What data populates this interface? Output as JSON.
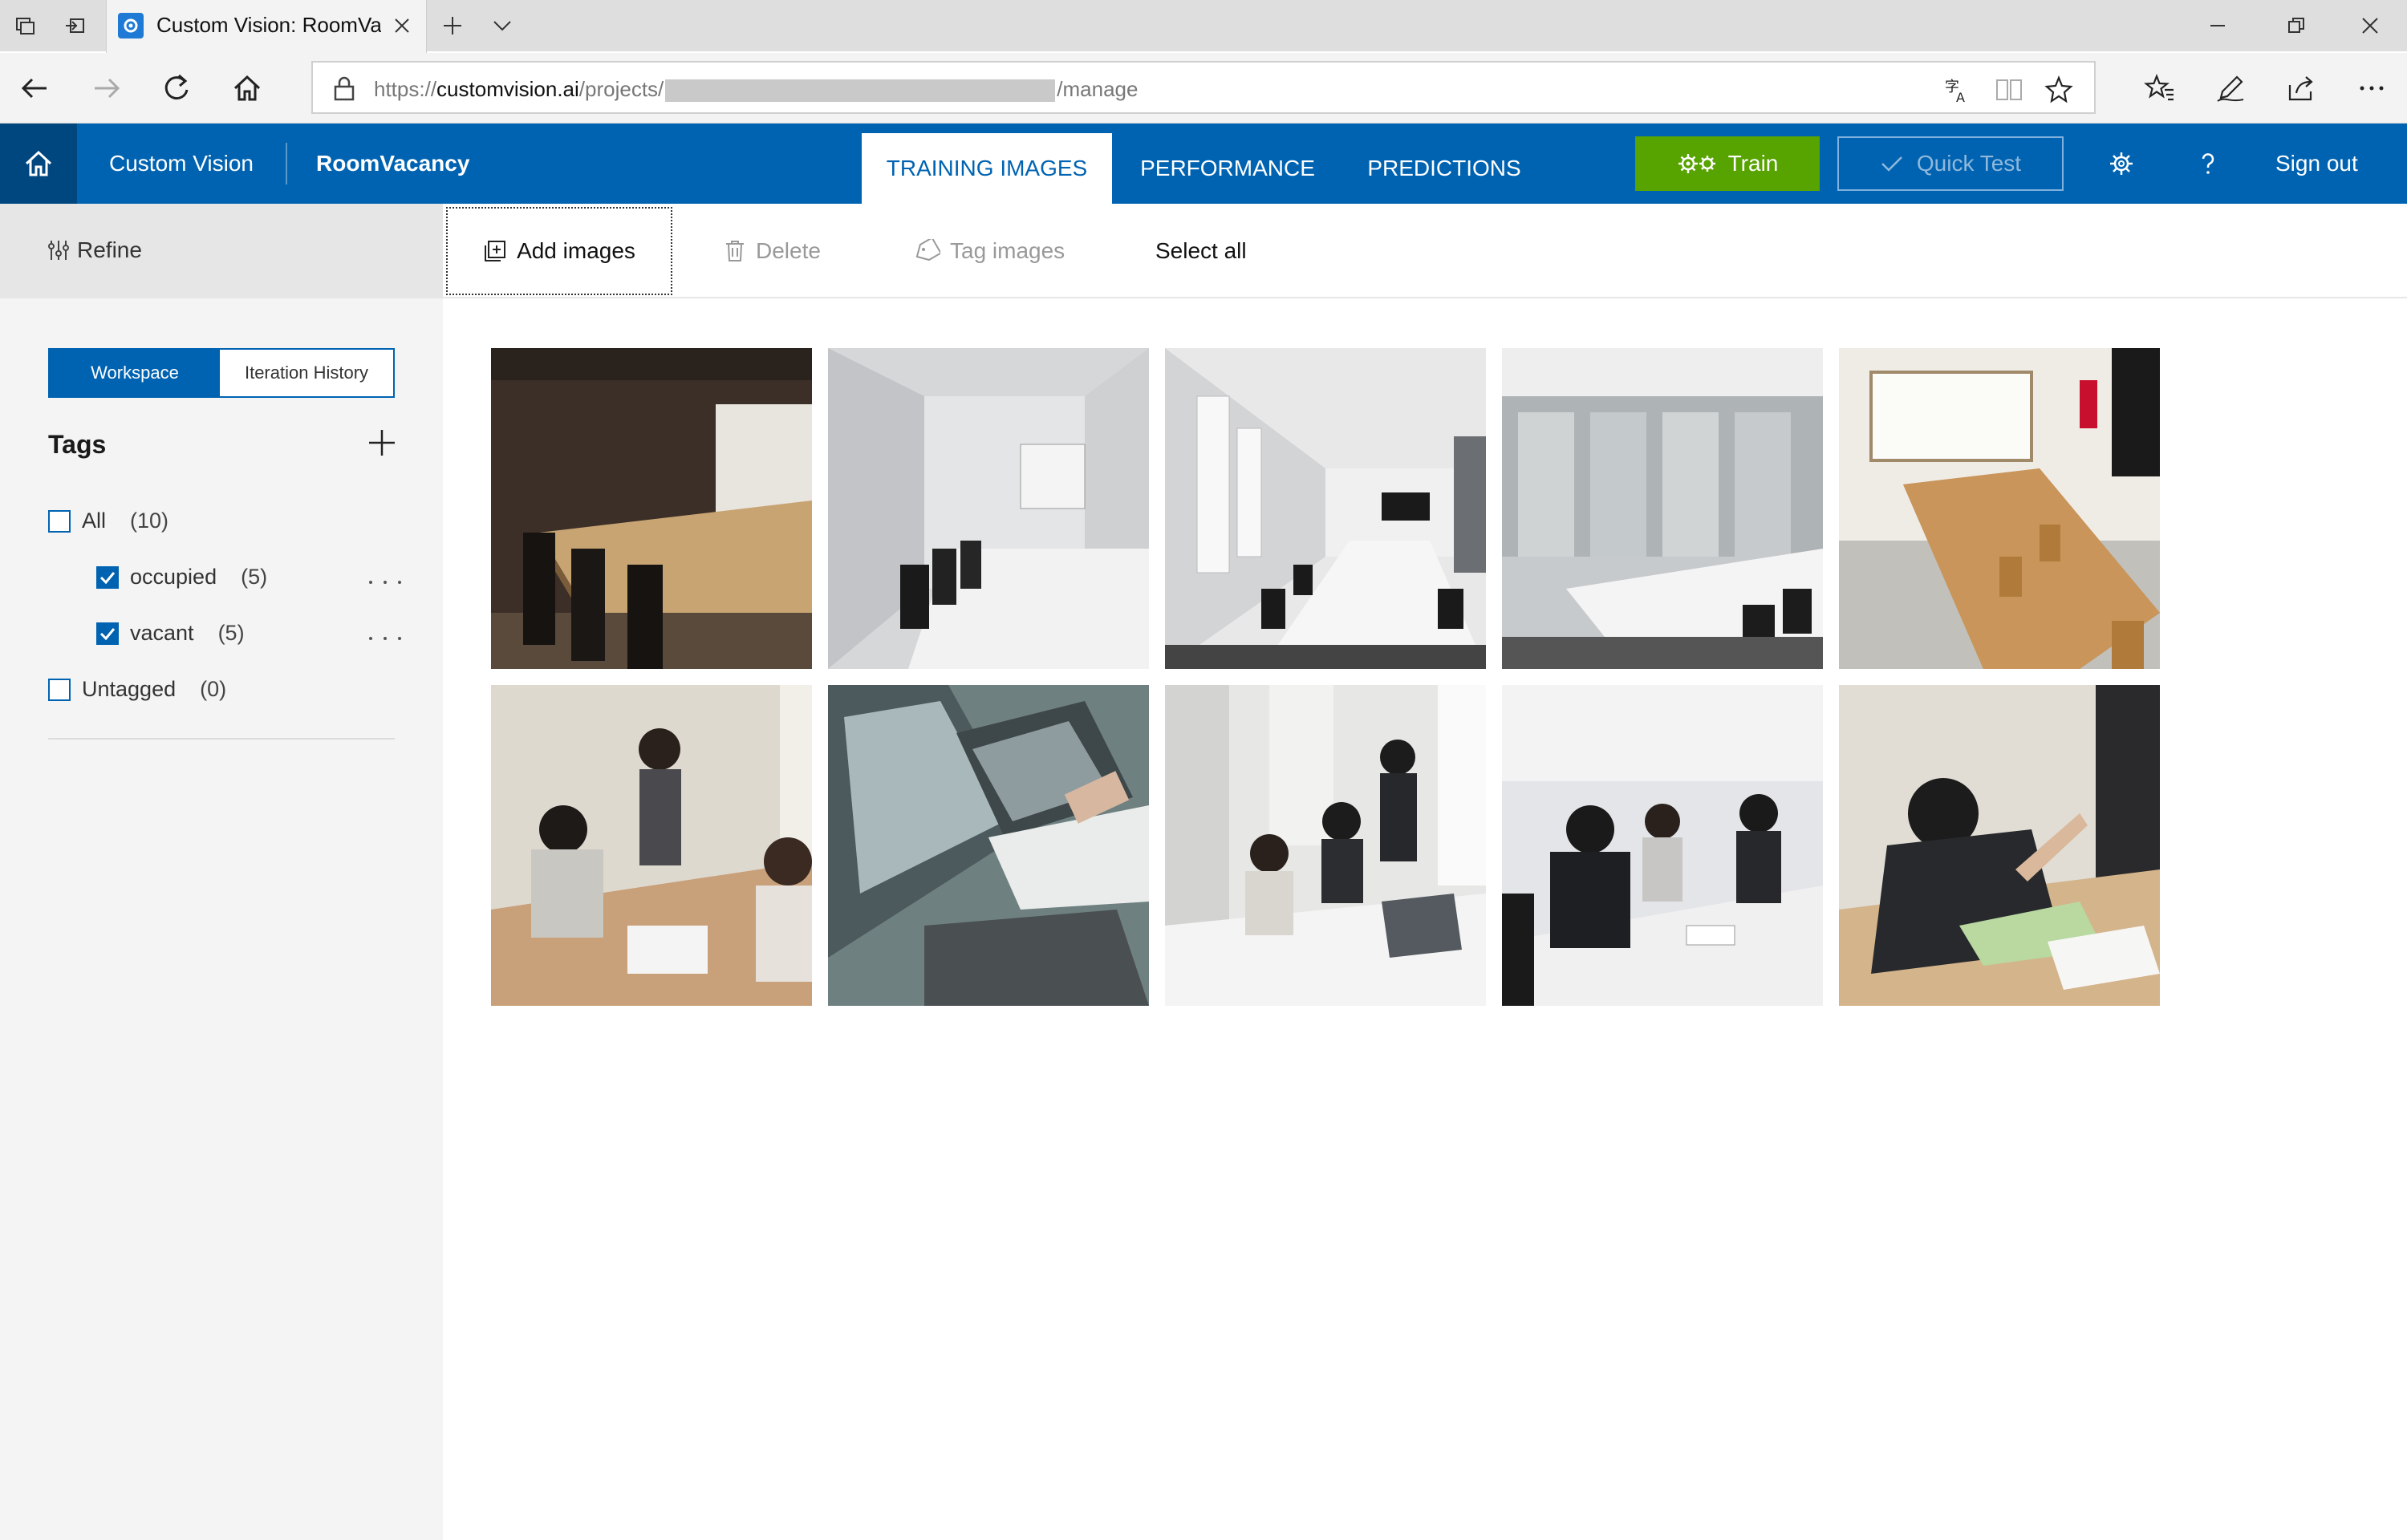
{
  "browser": {
    "tab_title": "Custom Vision: RoomVa",
    "url_scheme": "https://",
    "url_host": "customvision.ai",
    "url_path_start": "/projects/",
    "url_path_end": "/manage"
  },
  "header": {
    "brand": "Custom Vision",
    "project": "RoomVacancy",
    "tabs": [
      {
        "label": "TRAINING IMAGES",
        "active": true
      },
      {
        "label": "PERFORMANCE",
        "active": false
      },
      {
        "label": "PREDICTIONS",
        "active": false
      }
    ],
    "train_label": "Train",
    "quick_test_label": "Quick Test",
    "signout_label": "Sign out"
  },
  "sidebar": {
    "refine_label": "Refine",
    "segments": {
      "workspace": "Workspace",
      "history": "Iteration History"
    },
    "tags_title": "Tags",
    "tags": [
      {
        "label": "All",
        "count": "(10)",
        "checked": false
      },
      {
        "label": "occupied",
        "count": "(5)",
        "checked": true
      },
      {
        "label": "vacant",
        "count": "(5)",
        "checked": true
      },
      {
        "label": "Untagged",
        "count": "(0)",
        "checked": false
      }
    ]
  },
  "toolbar": {
    "add_images": "Add images",
    "delete": "Delete",
    "tag_images": "Tag images",
    "select_all": "Select all"
  },
  "images": [
    {
      "scene": "dark conference room with wooden table"
    },
    {
      "scene": "white meeting room with whiteboard"
    },
    {
      "scene": "long meeting room with monitor"
    },
    {
      "scene": "glass-walled conference room"
    },
    {
      "scene": "wooden table room with whiteboard"
    },
    {
      "scene": "presenter with seated colleagues"
    },
    {
      "scene": "laptops and hands writing"
    },
    {
      "scene": "team meeting with laptop"
    },
    {
      "scene": "business discussion at table"
    },
    {
      "scene": "people pointing at documents"
    }
  ],
  "colors": {
    "brand_blue": "#0063b1",
    "brand_dark": "#00467f",
    "train_green": "#57a300"
  }
}
